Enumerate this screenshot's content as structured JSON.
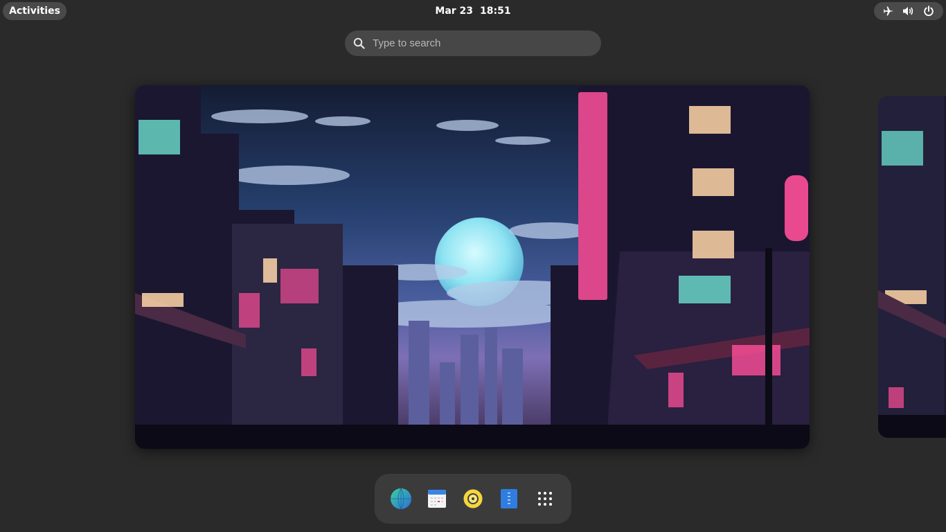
{
  "topbar": {
    "activities_label": "Activities",
    "date": "Mar 23",
    "time": "18:51",
    "tray_icons": [
      "airplane-mode-icon",
      "volume-icon",
      "power-icon"
    ]
  },
  "search": {
    "placeholder": "Type to search",
    "value": ""
  },
  "workspaces": [
    {
      "name": "workspace-1",
      "wallpaper": "neon-city-night"
    },
    {
      "name": "workspace-2",
      "wallpaper": "neon-city-night"
    }
  ],
  "dock": {
    "items": [
      {
        "icon": "web-browser-icon"
      },
      {
        "icon": "calendar-icon"
      },
      {
        "icon": "music-player-icon"
      },
      {
        "icon": "text-editor-icon"
      },
      {
        "icon": "app-grid-icon"
      }
    ]
  },
  "colors": {
    "background": "#2a2a2a",
    "pill": "#4a4a4a",
    "search_bg": "#474747",
    "dock_bg": "#3b3b3b",
    "neon_pink": "#ff4f9a",
    "moon": "#8fe8f5"
  }
}
